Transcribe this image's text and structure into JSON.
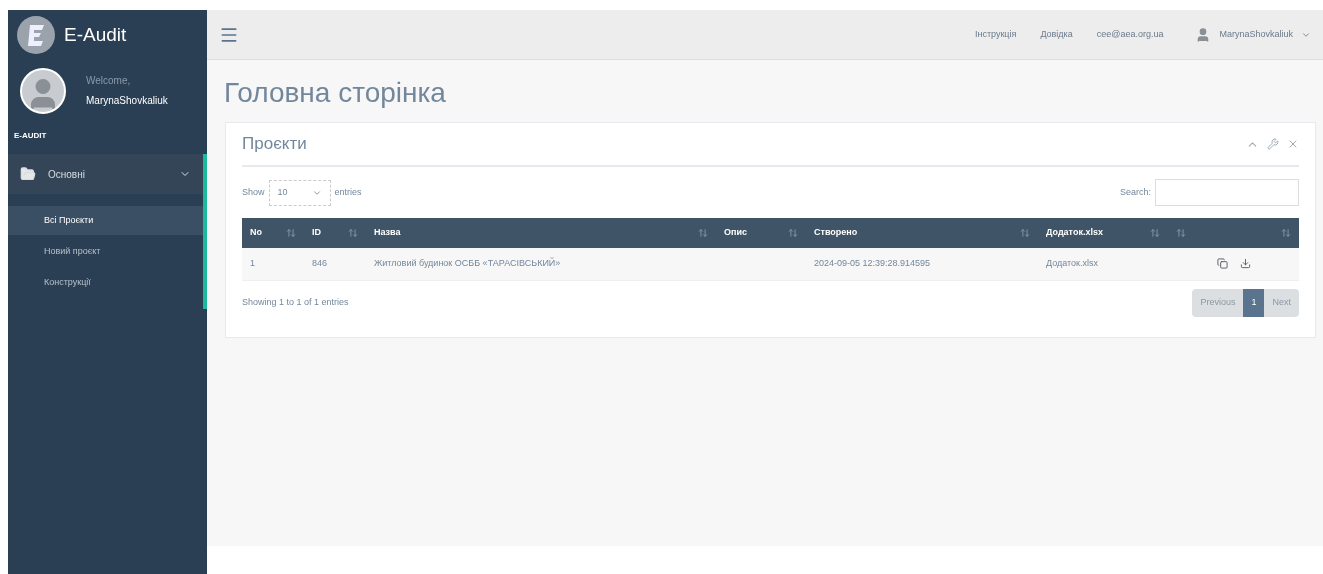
{
  "brand": {
    "title": "E-Audit"
  },
  "profile": {
    "greeting": "Welcome,",
    "name": "MarynaShovkaliuk"
  },
  "sidebar": {
    "section_title": "E-AUDIT",
    "menu": [
      {
        "label": "Основні",
        "expanded": true,
        "children": [
          {
            "label": "Всі Проєкти",
            "selected": true
          },
          {
            "label": "Новий проєкт",
            "selected": false
          },
          {
            "label": "Конструкції",
            "selected": false
          }
        ]
      }
    ]
  },
  "top_bar": {
    "links": [
      "Інструкція",
      "Довідка",
      "cee@aea.org.ua"
    ],
    "user": "MarynaShovkaliuk"
  },
  "page_title": "Головна сторінка",
  "panel": {
    "title": "Проєкти",
    "length": {
      "label_before": "Show",
      "value": "10",
      "label_after": "entries"
    },
    "search": {
      "label": "Search:"
    },
    "table": {
      "columns": [
        "No",
        "ID",
        "Назва",
        "Опис",
        "Створено",
        "Додаток.xlsx"
      ],
      "rows": [
        {
          "cells": [
            "1",
            "846",
            "Житловий будинок ОСББ «ТАРАСІВСЬКИЙ»",
            "",
            "2024-09-05 12:39:28.914595",
            "Додаток.xlsx"
          ]
        }
      ]
    },
    "info": "Showing 1 to 1 of 1 entries",
    "pagination": [
      {
        "label": "Previous",
        "selected": false
      },
      {
        "label": "1",
        "selected": true
      },
      {
        "label": "Next",
        "selected": false
      }
    ]
  }
}
